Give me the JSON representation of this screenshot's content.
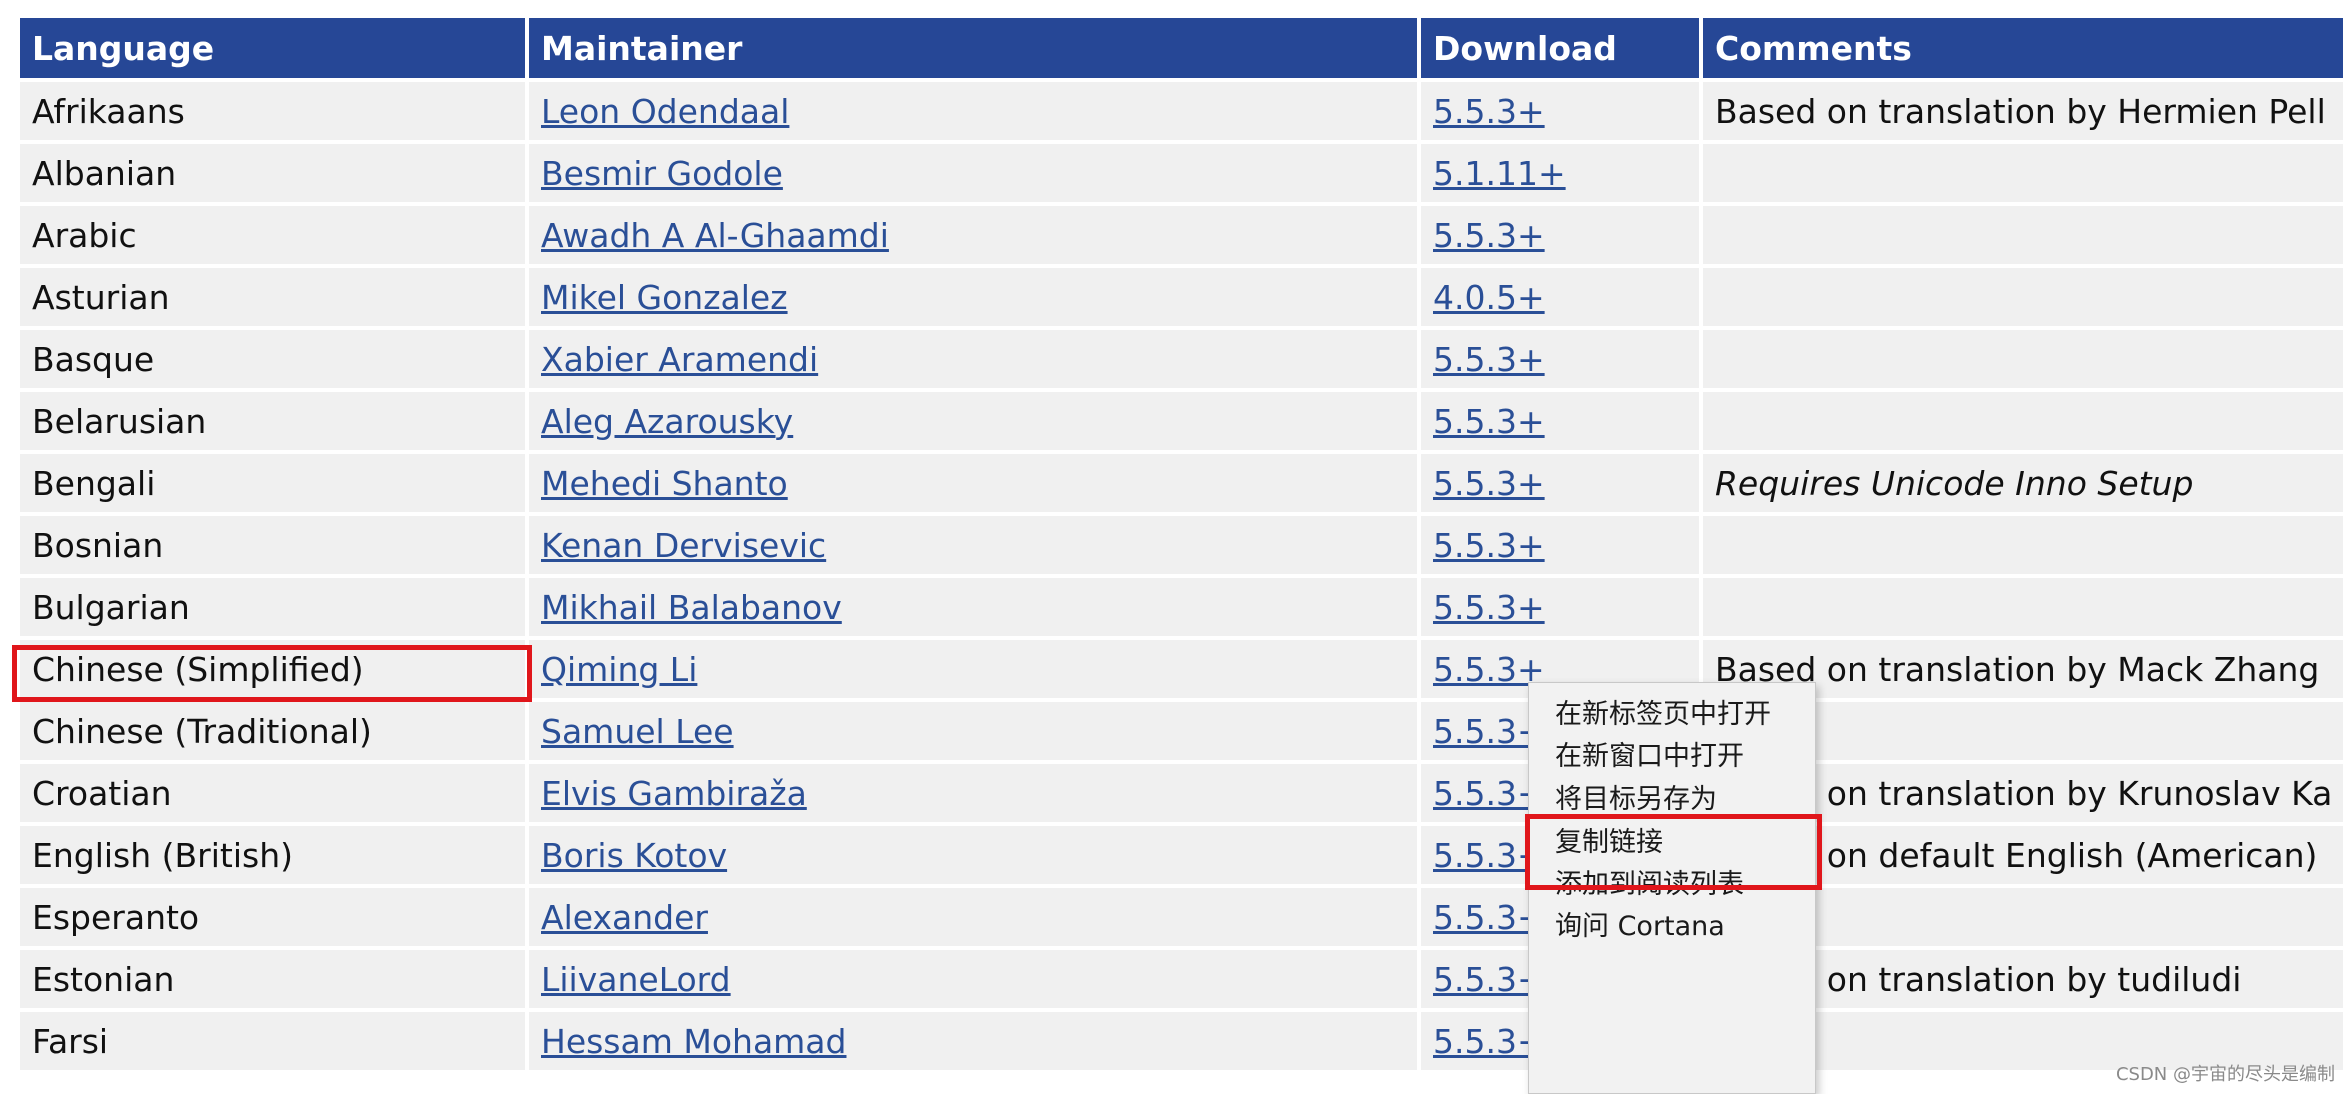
{
  "table": {
    "headers": [
      "Language",
      "Maintainer",
      "Download",
      "Comments"
    ],
    "rows": [
      {
        "language": "Afrikaans",
        "maintainer": "Leon Odendaal",
        "download": "5.5.3+",
        "comment": "Based on translation by Hermien Pell",
        "comment_italic": false
      },
      {
        "language": "Albanian",
        "maintainer": "Besmir Godole",
        "download": "5.1.11+",
        "comment": "",
        "comment_italic": false
      },
      {
        "language": "Arabic",
        "maintainer": "Awadh A Al-Ghaamdi",
        "download": "5.5.3+",
        "comment": "",
        "comment_italic": false
      },
      {
        "language": "Asturian",
        "maintainer": "Mikel Gonzalez",
        "download": "4.0.5+",
        "comment": "",
        "comment_italic": false
      },
      {
        "language": "Basque",
        "maintainer": "Xabier Aramendi",
        "download": "5.5.3+",
        "comment": "",
        "comment_italic": false
      },
      {
        "language": "Belarusian",
        "maintainer": "Aleg Azarousky",
        "download": "5.5.3+",
        "comment": "",
        "comment_italic": false
      },
      {
        "language": "Bengali",
        "maintainer": "Mehedi Shanto",
        "download": "5.5.3+",
        "comment": "Requires Unicode Inno Setup",
        "comment_italic": true
      },
      {
        "language": "Bosnian",
        "maintainer": "Kenan Dervisevic",
        "download": "5.5.3+",
        "comment": "",
        "comment_italic": false
      },
      {
        "language": "Bulgarian",
        "maintainer": "Mikhail Balabanov",
        "download": "5.5.3+",
        "comment": "",
        "comment_italic": false
      },
      {
        "language": "Chinese (Simplified)",
        "maintainer": "Qiming Li",
        "download": "5.5.3+",
        "comment": "Based on translation by Mack Zhang",
        "comment_italic": false
      },
      {
        "language": "Chinese (Traditional)",
        "maintainer": "Samuel Lee",
        "download": "5.5.3+",
        "comment": "",
        "comment_italic": false
      },
      {
        "language": "Croatian",
        "maintainer": "Elvis Gambiraža",
        "download": "5.5.3+",
        "comment": "Based on translation by Krunoslav Ka",
        "comment_italic": false
      },
      {
        "language": "English (British)",
        "maintainer": "Boris Kotov",
        "download": "5.5.3+",
        "comment": "Based on default English (American)",
        "comment_italic": false
      },
      {
        "language": "Esperanto",
        "maintainer": "Alexander",
        "download": "5.5.3+",
        "comment": "",
        "comment_italic": false
      },
      {
        "language": "Estonian",
        "maintainer": "LiivaneLord",
        "download": "5.5.3+",
        "comment": "Based on translation by tudiludi",
        "comment_italic": false
      },
      {
        "language": "Farsi",
        "maintainer": "Hessam Mohamad",
        "download": "5.5.3+",
        "comment": "",
        "comment_italic": false
      }
    ]
  },
  "context_menu": {
    "items": [
      "在新标签页中打开",
      "在新窗口中打开",
      "将目标另存为",
      "复制链接",
      "添加到阅读列表",
      "询问 Cortana"
    ],
    "highlighted_index": 2
  },
  "highlight_color": "#e0161b",
  "header_color": "#264796",
  "link_color": "#2a4f97",
  "watermark": "CSDN @宇宙的尽头是编制"
}
